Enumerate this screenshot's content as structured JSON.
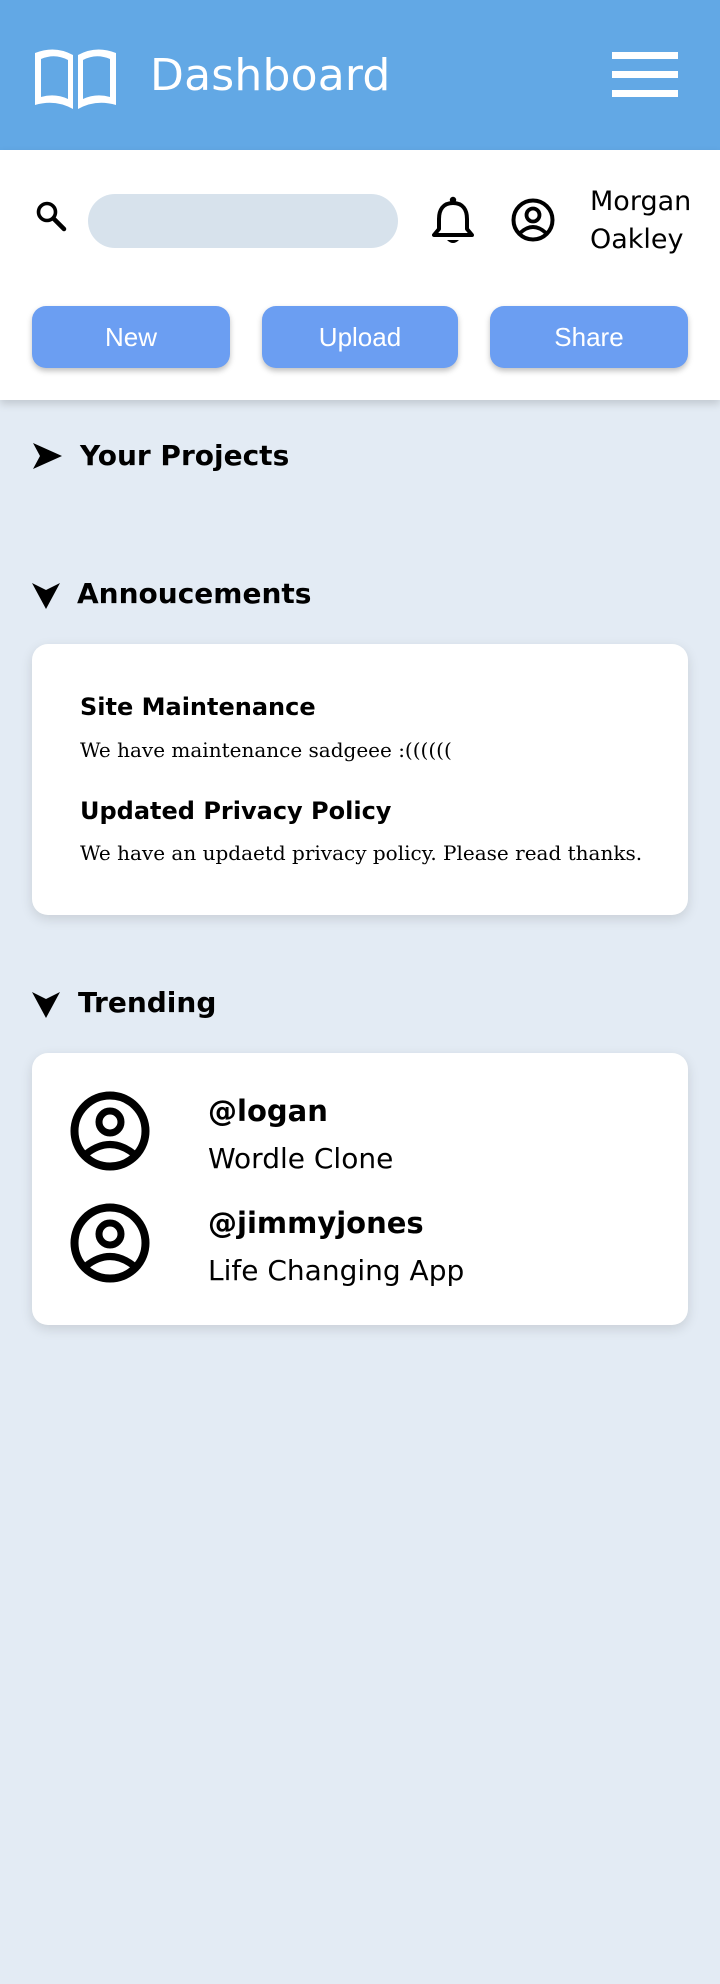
{
  "header": {
    "title": "Dashboard",
    "logo_icon": "open-book-icon",
    "menu_icon": "hamburger-menu-icon",
    "background": "#62a8e5"
  },
  "toolbar": {
    "search": {
      "value": "",
      "placeholder": "",
      "icon": "search-icon"
    },
    "notifications_icon": "bell-icon",
    "account_icon": "account-circle-icon",
    "user": {
      "first_name": "Morgan",
      "last_name": "Oakley"
    },
    "buttons": [
      {
        "label": "New"
      },
      {
        "label": "Upload"
      },
      {
        "label": "Share"
      }
    ],
    "button_color": "#6b9ef2"
  },
  "sections": {
    "projects": {
      "title": "Your Projects",
      "state": "collapsed"
    },
    "announcements": {
      "title": "Annoucements",
      "state": "expanded",
      "items": [
        {
          "title": "Site Maintenance",
          "body": "We have maintenance sadgeee :(((((("
        },
        {
          "title": "Updated Privacy Policy",
          "body": "We have an updaetd privacy policy. Please read thanks."
        }
      ]
    },
    "trending": {
      "title": "Trending",
      "state": "expanded",
      "items": [
        {
          "handle": "@logan",
          "project": "Wordle Clone"
        },
        {
          "handle": "@jimmyjones",
          "project": "Life Changing App"
        }
      ]
    }
  },
  "colors": {
    "page_background": "#e3ebf4",
    "card_background": "#ffffff"
  }
}
